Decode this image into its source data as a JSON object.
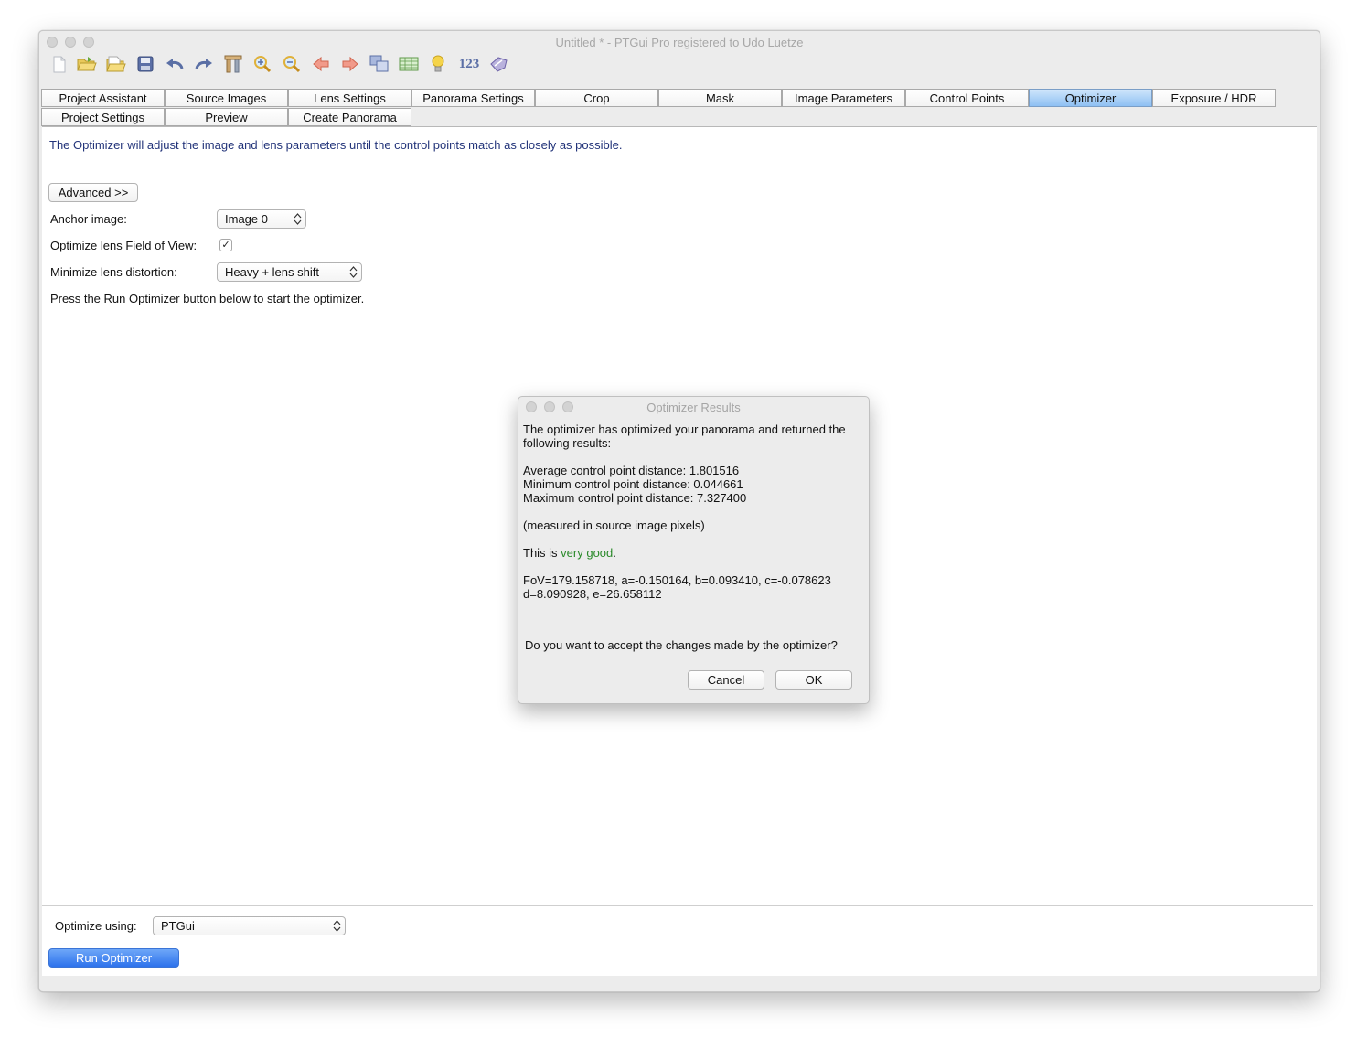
{
  "window": {
    "title": "Untitled * - PTGui Pro registered to Udo Luetze"
  },
  "toolbar": {
    "items": [
      {
        "icon": "new-document-icon"
      },
      {
        "icon": "open-folder-icon"
      },
      {
        "icon": "open-recent-icon"
      },
      {
        "icon": "save-icon"
      },
      {
        "icon": "undo-icon"
      },
      {
        "icon": "redo-icon"
      },
      {
        "icon": "tools-icon"
      },
      {
        "icon": "zoom-in-icon"
      },
      {
        "icon": "zoom-out-icon"
      },
      {
        "icon": "arrow-left-icon"
      },
      {
        "icon": "arrow-right-icon"
      },
      {
        "icon": "copy-images-icon"
      },
      {
        "icon": "table-icon"
      },
      {
        "icon": "lightbulb-icon"
      },
      {
        "icon": "numbers-icon",
        "label": "123"
      },
      {
        "icon": "tag-icon"
      }
    ]
  },
  "tabs": {
    "row1": [
      "Project Assistant",
      "Source Images",
      "Lens Settings",
      "Panorama Settings",
      "Crop",
      "Mask",
      "Image Parameters",
      "Control Points",
      "Optimizer",
      "Exposure / HDR"
    ],
    "row2": [
      "Project Settings",
      "Preview",
      "Create Panorama"
    ],
    "active": "Optimizer"
  },
  "optimizer": {
    "info": "The Optimizer will adjust the image and lens parameters until the control points match as closely as possible.",
    "advanced_label": "Advanced >>",
    "anchor_label": "Anchor image:",
    "anchor_value": "Image 0",
    "fov_label": "Optimize lens Field of View:",
    "fov_checked": true,
    "distortion_label": "Minimize lens distortion:",
    "distortion_value": "Heavy + lens shift",
    "press_text": "Press the Run Optimizer button below to start the optimizer.",
    "optimize_using_label": "Optimize using:",
    "optimize_using_value": "PTGui",
    "run_label": "Run Optimizer"
  },
  "dialog": {
    "title": "Optimizer Results",
    "intro_line1": "The optimizer has optimized your panorama and returned the",
    "intro_line2": "following results:",
    "avg": "Average control point distance: 1.801516",
    "min": "Minimum control point distance: 0.044661",
    "max": "Maximum control point distance: 7.327400",
    "measured": "(measured in source image pixels)",
    "quality_prefix": "This is ",
    "quality_value": "very good",
    "quality_suffix": ".",
    "params_line1": "FoV=179.158718, a=-0.150164, b=0.093410, c=-0.078623",
    "params_line2": "d=8.090928, e=26.658112",
    "question": "Do you want to accept the changes made by the optimizer?",
    "cancel_label": "Cancel",
    "ok_label": "OK"
  },
  "colors": {
    "accent": "#2d72ec",
    "active_tab": "#a7cff6",
    "info_text": "#23347a",
    "good": "#2b8a2b"
  }
}
